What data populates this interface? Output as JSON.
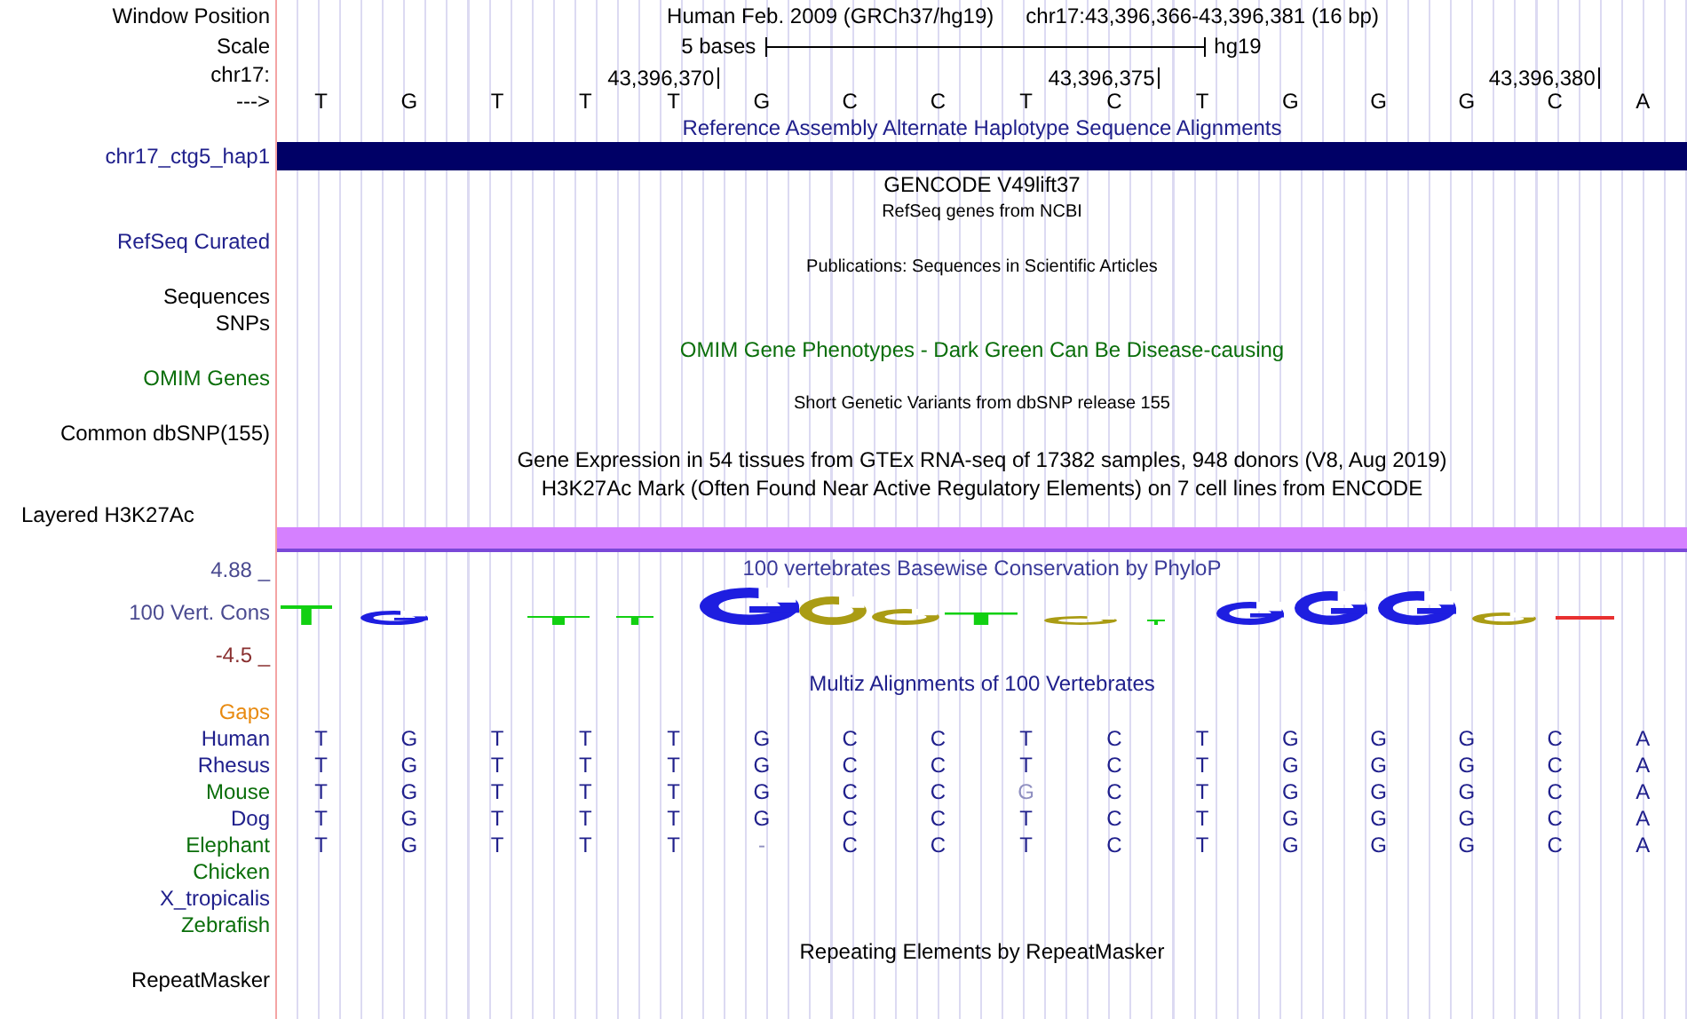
{
  "position": {
    "label": "Window Position",
    "assembly": "Human Feb. 2009 (GRCh37/hg19)",
    "range": "chr17:43,396,366-43,396,381 (16 bp)"
  },
  "scale": {
    "label": "Scale",
    "length": "5 bases",
    "assembly": "hg19"
  },
  "coordinates": {
    "label": "chr17:",
    "ticks": [
      "43,396,370",
      "43,396,375",
      "43,396,380"
    ]
  },
  "sequence": {
    "label": "--->",
    "bases": [
      "T",
      "G",
      "T",
      "T",
      "T",
      "G",
      "C",
      "C",
      "T",
      "C",
      "T",
      "G",
      "G",
      "G",
      "C",
      "A"
    ]
  },
  "tracks": [
    {
      "kind": "title",
      "text": "Reference Assembly Alternate Haplotype Sequence Alignments",
      "color": "#20208c"
    },
    {
      "kind": "bar",
      "label": "chr17_ctg5_hap1",
      "color": "#000066"
    },
    {
      "kind": "title",
      "text": "GENCODE V49lift37",
      "color": "#000000"
    },
    {
      "kind": "note",
      "text": "RefSeq genes from NCBI"
    },
    {
      "kind": "label",
      "text": "RefSeq Curated",
      "color": "#20208c"
    },
    {
      "kind": "note",
      "text": "Publications: Sequences in Scientific Articles"
    },
    {
      "kind": "label",
      "text": "Sequences",
      "color": "#000000"
    },
    {
      "kind": "label",
      "text": "SNPs",
      "color": "#000000"
    },
    {
      "kind": "title",
      "text": "OMIM Gene Phenotypes - Dark Green Can Be Disease-causing",
      "color": "#0a6e0a"
    },
    {
      "kind": "label",
      "text": "OMIM Genes",
      "color": "#0a6e0a"
    },
    {
      "kind": "note",
      "text": "Short Genetic Variants from dbSNP release 155"
    },
    {
      "kind": "label",
      "text": "Common dbSNP(155)",
      "color": "#000000"
    },
    {
      "kind": "title",
      "text": "Gene Expression in 54 tissues from GTEx RNA-seq of 17382 samples, 948 donors (V8, Aug 2019)",
      "color": "#000000"
    },
    {
      "kind": "title",
      "text": "H3K27Ac Mark (Often Found Near Active Regulatory Elements) on 7 cell lines from ENCODE",
      "color": "#000000"
    },
    {
      "kind": "group_label",
      "text": "Layered H3K27Ac"
    },
    {
      "kind": "bar",
      "color": "#d580ff"
    },
    {
      "kind": "conservation",
      "title": "100 vertebrates Basewise Conservation by PhyloP",
      "label": "100 Vert. Cons",
      "max": "4.88 _",
      "min": "-4.5 _"
    },
    {
      "kind": "title",
      "text": "Multiz Alignments of 100 Vertebrates",
      "color": "#20208c"
    },
    {
      "kind": "label",
      "text": "Gaps",
      "color": "#e88a10"
    },
    {
      "kind": "species",
      "text": "Human",
      "color": "#20208c",
      "bases": [
        {
          "text": "T",
          "match": true
        },
        {
          "text": "G",
          "match": true
        },
        {
          "text": "T",
          "match": true
        },
        {
          "text": "T",
          "match": true
        },
        {
          "text": "T",
          "match": true
        },
        {
          "text": "G",
          "match": true
        },
        {
          "text": "C",
          "match": true
        },
        {
          "text": "C",
          "match": true
        },
        {
          "text": "T",
          "match": true
        },
        {
          "text": "C",
          "match": true
        },
        {
          "text": "T",
          "match": true
        },
        {
          "text": "G",
          "match": true
        },
        {
          "text": "G",
          "match": true
        },
        {
          "text": "G",
          "match": true
        },
        {
          "text": "C",
          "match": true
        },
        {
          "text": "A",
          "match": true
        }
      ]
    },
    {
      "kind": "species",
      "text": "Rhesus",
      "color": "#20208c",
      "bases": [
        {
          "text": "T",
          "match": true
        },
        {
          "text": "G",
          "match": true
        },
        {
          "text": "T",
          "match": true
        },
        {
          "text": "T",
          "match": true
        },
        {
          "text": "T",
          "match": true
        },
        {
          "text": "G",
          "match": true
        },
        {
          "text": "C",
          "match": true
        },
        {
          "text": "C",
          "match": true
        },
        {
          "text": "T",
          "match": true
        },
        {
          "text": "C",
          "match": true
        },
        {
          "text": "T",
          "match": true
        },
        {
          "text": "G",
          "match": true
        },
        {
          "text": "G",
          "match": true
        },
        {
          "text": "G",
          "match": true
        },
        {
          "text": "C",
          "match": true
        },
        {
          "text": "A",
          "match": true
        }
      ]
    },
    {
      "kind": "species",
      "text": "Mouse",
      "color": "#0a6e0a",
      "bases": [
        {
          "text": "T",
          "match": true
        },
        {
          "text": "G",
          "match": true
        },
        {
          "text": "T",
          "match": true
        },
        {
          "text": "T",
          "match": true
        },
        {
          "text": "T",
          "match": true
        },
        {
          "text": "G",
          "match": true
        },
        {
          "text": "C",
          "match": true
        },
        {
          "text": "C",
          "match": true
        },
        {
          "text": "G",
          "match": false
        },
        {
          "text": "C",
          "match": true
        },
        {
          "text": "T",
          "match": true
        },
        {
          "text": "G",
          "match": true
        },
        {
          "text": "G",
          "match": true
        },
        {
          "text": "G",
          "match": true
        },
        {
          "text": "C",
          "match": true
        },
        {
          "text": "A",
          "match": true
        }
      ]
    },
    {
      "kind": "species",
      "text": "Dog",
      "color": "#20208c",
      "bases": [
        {
          "text": "T",
          "match": true
        },
        {
          "text": "G",
          "match": true
        },
        {
          "text": "T",
          "match": true
        },
        {
          "text": "T",
          "match": true
        },
        {
          "text": "T",
          "match": true
        },
        {
          "text": "G",
          "match": true
        },
        {
          "text": "C",
          "match": true
        },
        {
          "text": "C",
          "match": true
        },
        {
          "text": "T",
          "match": true
        },
        {
          "text": "C",
          "match": true
        },
        {
          "text": "T",
          "match": true
        },
        {
          "text": "G",
          "match": true
        },
        {
          "text": "G",
          "match": true
        },
        {
          "text": "G",
          "match": true
        },
        {
          "text": "C",
          "match": true
        },
        {
          "text": "A",
          "match": true
        }
      ]
    },
    {
      "kind": "species",
      "text": "Elephant",
      "color": "#0a6e0a",
      "bases": [
        {
          "text": "T",
          "match": true
        },
        {
          "text": "G",
          "match": true
        },
        {
          "text": "T",
          "match": true
        },
        {
          "text": "T",
          "match": true
        },
        {
          "text": "T",
          "match": true
        },
        {
          "text": "-",
          "match": false
        },
        {
          "text": "C",
          "match": true
        },
        {
          "text": "C",
          "match": true
        },
        {
          "text": "T",
          "match": true
        },
        {
          "text": "C",
          "match": true
        },
        {
          "text": "T",
          "match": true
        },
        {
          "text": "G",
          "match": true
        },
        {
          "text": "G",
          "match": true
        },
        {
          "text": "G",
          "match": true
        },
        {
          "text": "C",
          "match": true
        },
        {
          "text": "A",
          "match": true
        }
      ]
    },
    {
      "kind": "species",
      "text": "Chicken",
      "color": "#0a6e0a"
    },
    {
      "kind": "species",
      "text": "X_tropicalis",
      "color": "#20208c"
    },
    {
      "kind": "species",
      "text": "Zebrafish",
      "color": "#0a6e0a"
    },
    {
      "kind": "title",
      "text": "Repeating Elements by RepeatMasker",
      "color": "#000000"
    },
    {
      "kind": "label",
      "text": "RepeatMasker",
      "color": "#000000"
    }
  ]
}
